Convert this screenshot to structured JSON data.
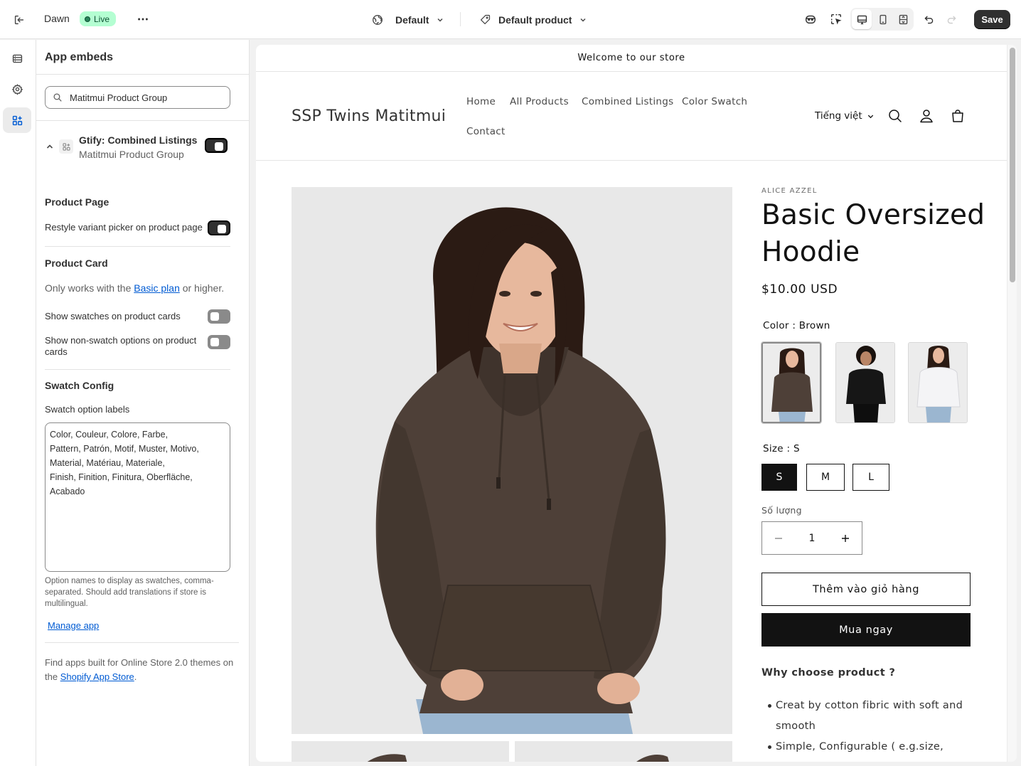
{
  "topbar": {
    "theme_name": "Dawn",
    "live_badge": "Live",
    "template_selector": "Default",
    "product_selector": "Default product",
    "save_label": "Save"
  },
  "panel": {
    "title": "App embeds",
    "search_value": "Matitmui Product Group",
    "embed": {
      "name": "Gtify: Combined Listings",
      "subtitle": "Matitmui Product Group",
      "enabled": true
    },
    "product_page": {
      "heading": "Product Page",
      "restyle_label": "Restyle variant picker on product page",
      "restyle_enabled": true
    },
    "product_card": {
      "heading": "Product Card",
      "note_prefix": "Only works with the ",
      "note_link": "Basic plan",
      "note_suffix": " or higher.",
      "show_swatches_label": "Show swatches on product cards",
      "show_swatches_enabled": false,
      "show_non_swatch_label": "Show non-swatch options on product cards",
      "show_non_swatch_enabled": false
    },
    "swatch_config": {
      "heading": "Swatch Config",
      "labels_title": "Swatch option labels",
      "labels_value": "Color, Couleur, Colore, Farbe,\nPattern, Patrón, Motif, Muster, Motivo,\nMaterial, Matériau, Materiale,\nFinish, Finition, Finitura, Oberfläche,\nAcabado",
      "help": "Option names to display as swatches, comma-separated. Should add translations if store is multilingual."
    },
    "manage_app": "Manage app",
    "footer_prefix": "Find apps built for Online Store 2.0 themes on the ",
    "footer_link": "Shopify App Store",
    "footer_suffix": "."
  },
  "store": {
    "announcement": "Welcome to our store",
    "name": "SSP Twins Matitmui",
    "nav": [
      "Home",
      "All Products",
      "Combined Listings",
      "Color Swatch",
      "Contact"
    ],
    "language": "Tiếng việt"
  },
  "product": {
    "vendor": "ALICE AZZEL",
    "title": "Basic Oversized Hoodie",
    "price": "$10.00 USD",
    "color_label": "Color : Brown",
    "colors": [
      "Brown",
      "Black",
      "White"
    ],
    "size_label": "Size : S",
    "sizes": [
      "S",
      "M",
      "L"
    ],
    "selected_size": "S",
    "quantity_label": "Số lượng",
    "quantity": "1",
    "add_to_cart": "Thêm vào giỏ hàng",
    "buy_now": "Mua ngay",
    "why_heading": "Why choose product ?",
    "bullets": [
      "Creat by cotton fibric with soft and smooth",
      "Simple, Configurable ( e.g.size,"
    ]
  },
  "colors": {
    "accent_dark": "#303030",
    "live_badge_bg": "#b4fed2",
    "link": "#005bd3",
    "hoodie_brown": "#4e4038"
  }
}
